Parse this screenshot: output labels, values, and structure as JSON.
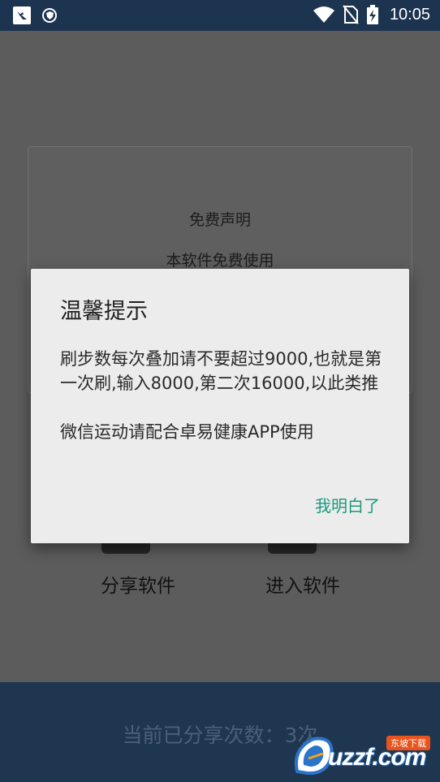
{
  "status_bar": {
    "time": "10:05",
    "icons": [
      "app-notification-icon",
      "shield-notification-icon",
      "wifi-icon",
      "no-sim-icon",
      "battery-charging-icon"
    ]
  },
  "background": {
    "notice_title": "免费声明",
    "notice_text": "本软件免费使用",
    "share_label": "分享软件",
    "enter_label": "进入软件",
    "share_count": "当前已分享次数：3次"
  },
  "dialog": {
    "title": "温馨提示",
    "message_1": "刷步数每次叠加请不要超过9000,也就是第一次刷,输入8000,第二次16000,以此类推",
    "message_2": "微信运动请配合卓易健康APP使用",
    "button_label": "我明白了"
  },
  "watermark": {
    "text": "uzzf.com",
    "tag": "东坡下载"
  },
  "colors": {
    "status_bar": "#1d3450",
    "accent": "#1a9a7c",
    "dialog_bg": "#ececec"
  }
}
